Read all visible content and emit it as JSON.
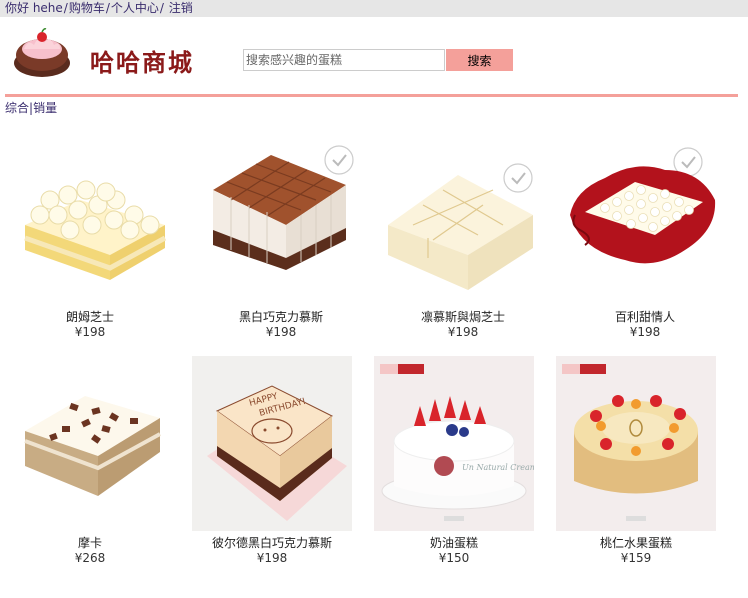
{
  "topbar": {
    "greeting": "你好 hehe",
    "cart": "购物车",
    "profile": "个人中心",
    "logout": " 注销",
    "separator": "/"
  },
  "header": {
    "brand": "哈哈商城",
    "search_placeholder": "搜索感兴趣的蛋糕",
    "search_button": "搜索"
  },
  "sort": {
    "overall": "综合",
    "separator": "|",
    "sales": "销量"
  },
  "currency": "¥",
  "products": [
    {
      "name": "朗姆芝士",
      "price": "¥198"
    },
    {
      "name": "黑白巧克力慕斯",
      "price": "¥198"
    },
    {
      "name": "凛慕斯與焗芝士",
      "price": "¥198"
    },
    {
      "name": "百利甜情人",
      "price": "¥198"
    },
    {
      "name": "摩卡",
      "price": "¥268"
    },
    {
      "name": "彼尔德黑白巧克力慕斯",
      "price": "¥198"
    },
    {
      "name": "奶油蛋糕",
      "price": "¥150"
    },
    {
      "name": "桃仁水果蛋糕",
      "price": "¥159"
    }
  ],
  "colors": {
    "accent": "#f4a09a",
    "brand": "#8b1a1a",
    "link": "#3a2d6e"
  }
}
